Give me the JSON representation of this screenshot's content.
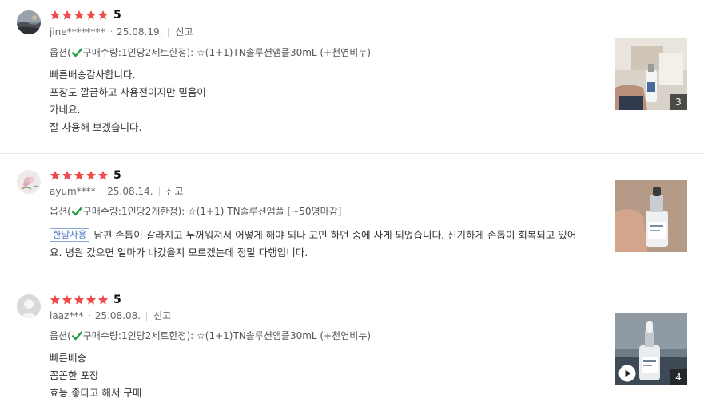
{
  "colors": {
    "star": "#f04b4b",
    "check": "#1e9e3e",
    "tag": "#4a78c0"
  },
  "reviews": [
    {
      "score": "5",
      "user": "jine********",
      "date": "25.08.19.",
      "report": "신고",
      "option_prefix": "옵션(",
      "option_text": "구매수량:1인당2세트한정): ☆(1+1)TN솔루션앰플30mL (+천연비누)",
      "tag": "",
      "lines": [
        "빠른배송감사합니다.",
        "포장도 깔끔하고 사용전이지만 믿음이",
        "가네요.",
        "잘 사용해 보겠습니다."
      ],
      "photo_count": "3",
      "avatar_icon": "landscape-avatar-icon"
    },
    {
      "score": "5",
      "user": "ayum****",
      "date": "25.08.14.",
      "report": "신고",
      "option_prefix": "옵션(",
      "option_text": "구매수량:1인당2개한정): ☆(1+1) TN솔루션앰플 [~50명마감]",
      "tag": "한달사용",
      "text": "남편 손톱이 갈라지고 두꺼워져서 어떻게 해야 되나 고민 하던 중에 사게 되었습니다. 신기하게 손톱이 회복되고 있어요. 병원 갔으면 얼마가 나갔을지 모르겠는데 정말 다행입니다.",
      "photo_count": "",
      "avatar_icon": "flower-avatar-icon"
    },
    {
      "score": "5",
      "user": "laaz***",
      "date": "25.08.08.",
      "report": "신고",
      "option_prefix": "옵션(",
      "option_text": "구매수량:1인당2세트한정): ☆(1+1)TN솔루션앰플30mL (+천연비누)",
      "tag": "",
      "lines": [
        "빠른배송",
        "꼼꼼한 포장",
        "효능 좋다고 해서 구매"
      ],
      "photo_count": "4",
      "avatar_icon": "default-avatar-icon"
    }
  ]
}
